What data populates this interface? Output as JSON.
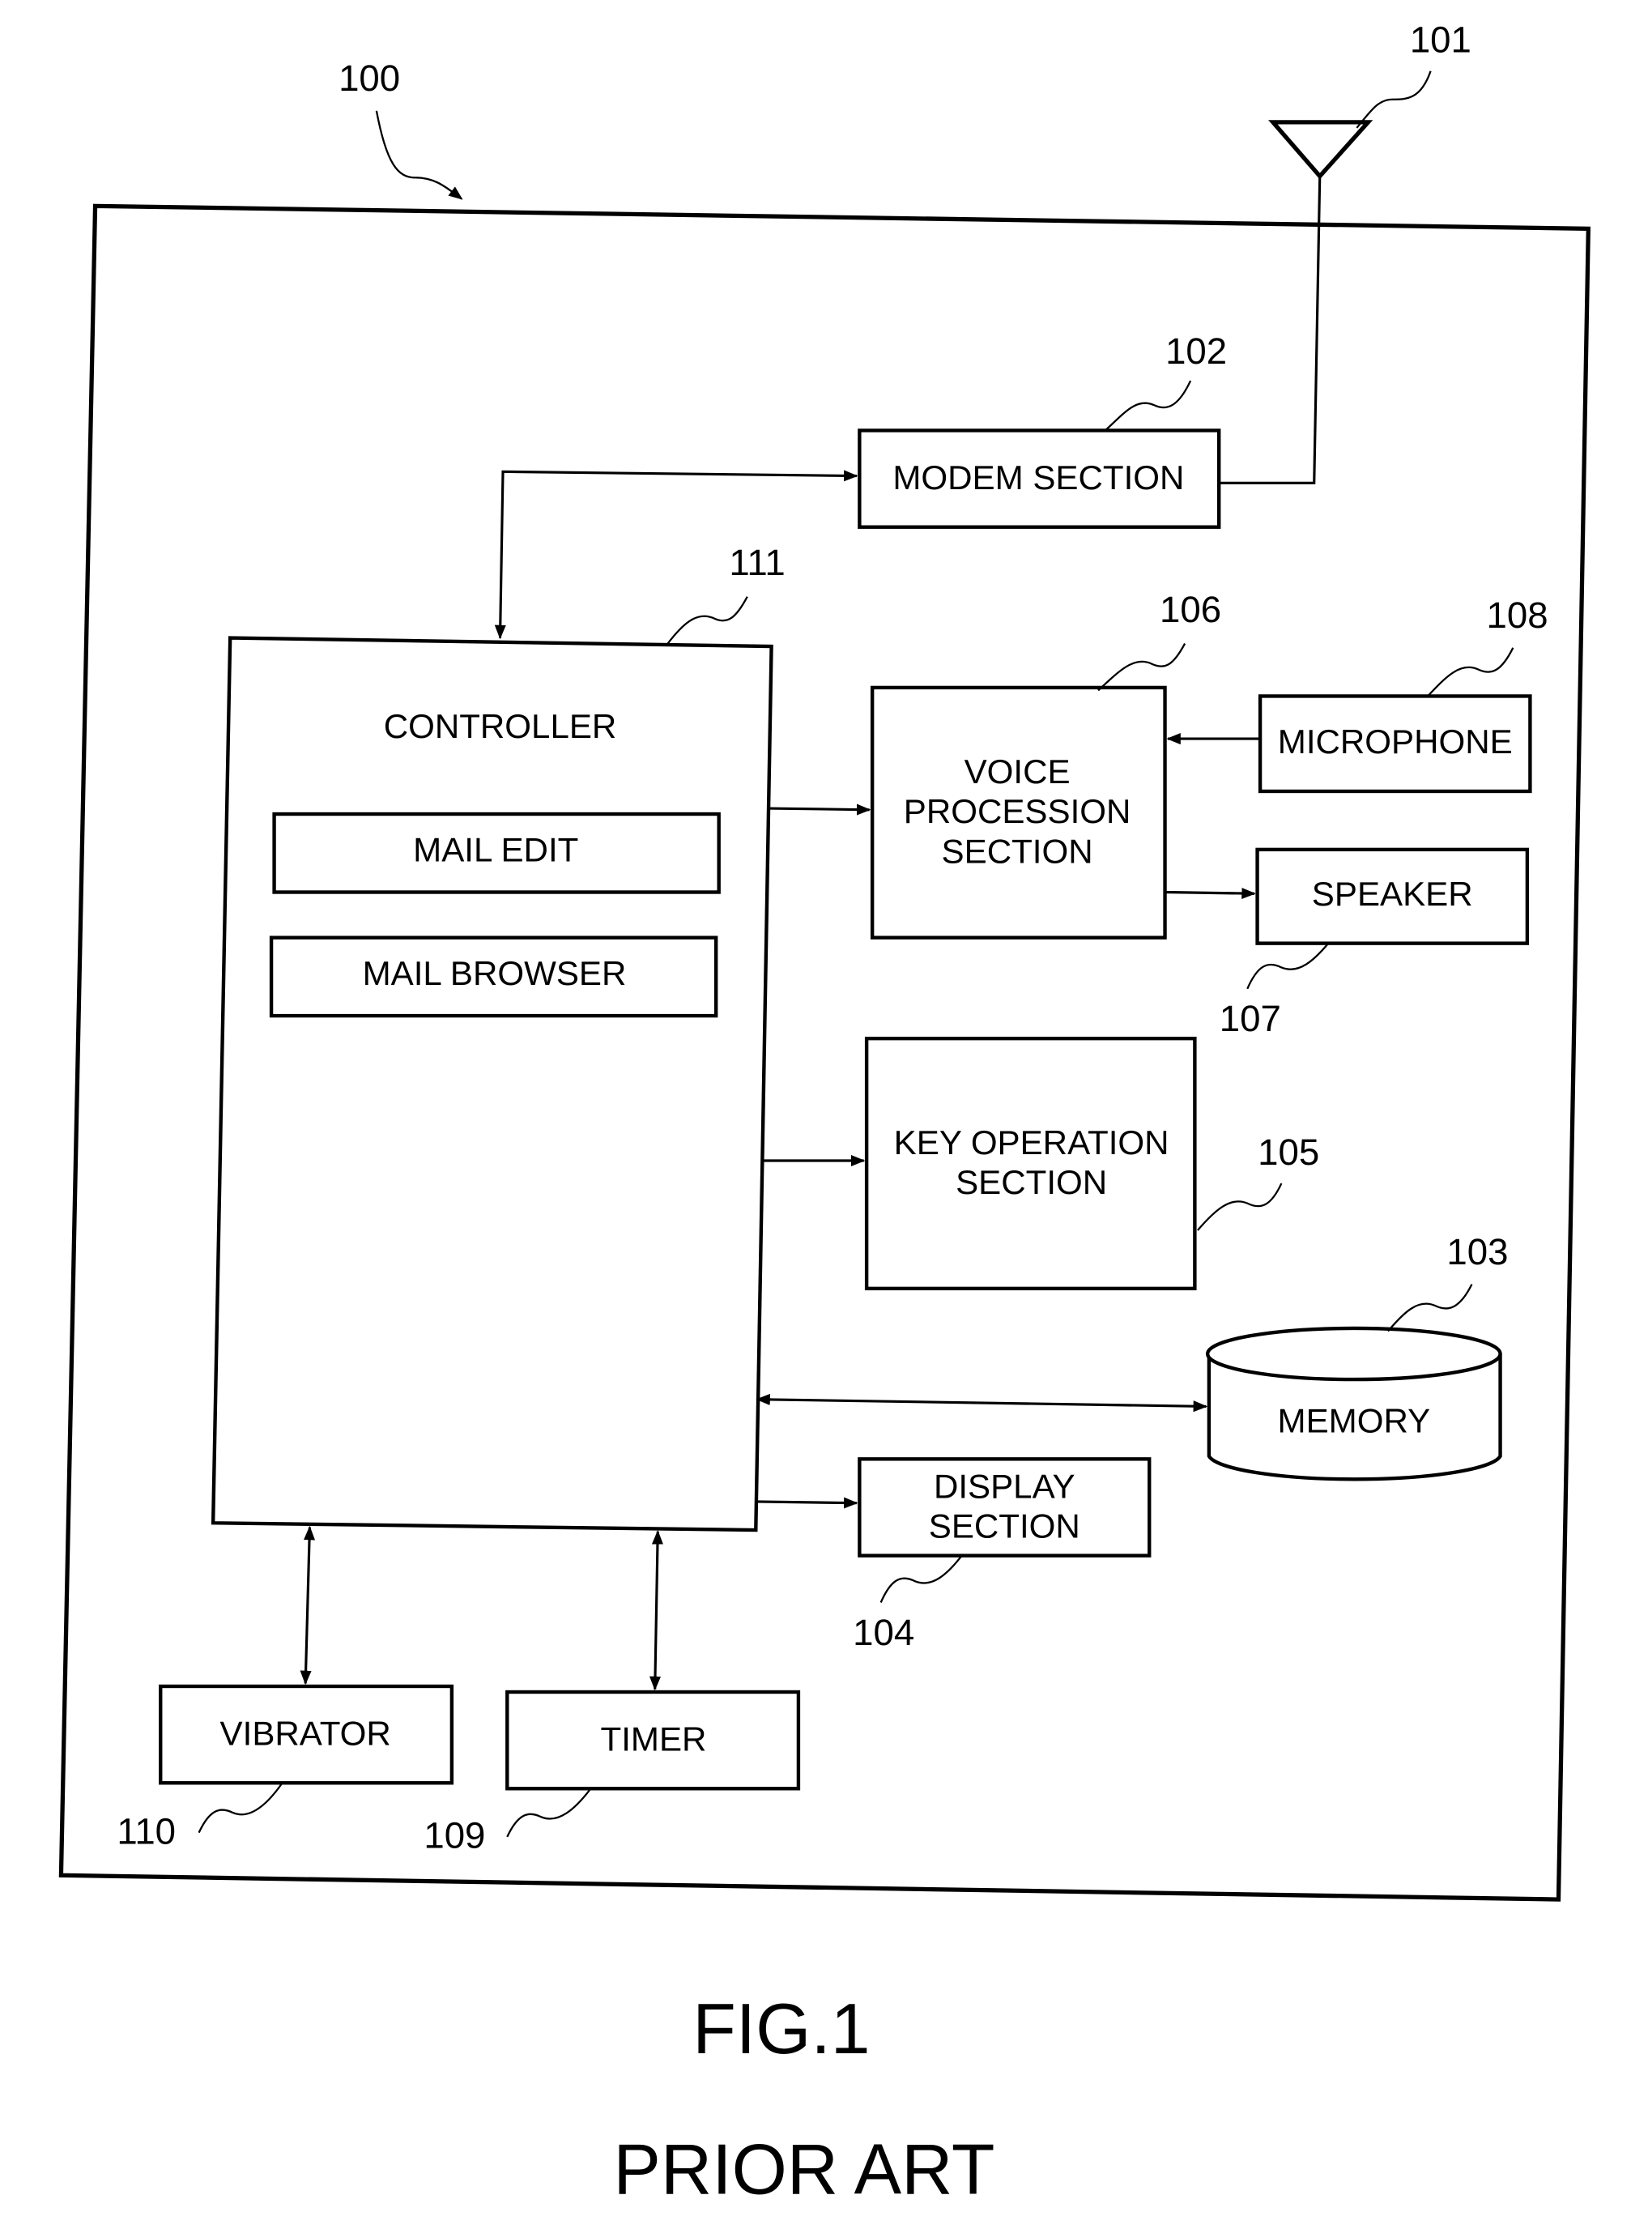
{
  "figure": {
    "caption": "FIG.1",
    "subcaption": "PRIOR ART"
  },
  "device": {
    "ref": "100"
  },
  "antenna": {
    "ref": "101"
  },
  "blocks": {
    "modem": {
      "ref": "102",
      "lines": [
        "MODEM SECTION"
      ]
    },
    "memory": {
      "ref": "103",
      "lines": [
        "MEMORY"
      ]
    },
    "display": {
      "ref": "104",
      "lines": [
        "DISPLAY",
        "SECTION"
      ]
    },
    "key_operation": {
      "ref": "105",
      "lines": [
        "KEY OPERATION",
        "SECTION"
      ]
    },
    "voice": {
      "ref": "106",
      "lines": [
        "VOICE",
        "PROCESSION",
        "SECTION"
      ]
    },
    "speaker": {
      "ref": "107",
      "lines": [
        "SPEAKER"
      ]
    },
    "microphone": {
      "ref": "108",
      "lines": [
        "MICROPHONE"
      ]
    },
    "timer": {
      "ref": "109",
      "lines": [
        "TIMER"
      ]
    },
    "vibrator": {
      "ref": "110",
      "lines": [
        "VIBRATOR"
      ]
    },
    "controller": {
      "ref": "111",
      "lines": [
        "CONTROLLER"
      ],
      "modules": [
        "MAIL EDIT",
        "MAIL BROWSER"
      ]
    }
  }
}
